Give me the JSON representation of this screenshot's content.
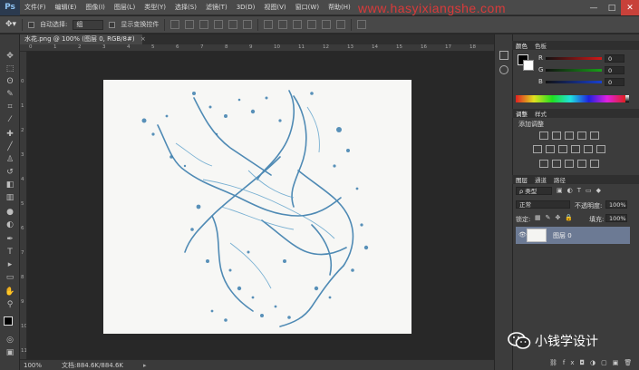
{
  "app": {
    "logo": "Ps"
  },
  "menu": [
    "文件(F)",
    "编辑(E)",
    "图像(I)",
    "图层(L)",
    "类型(Y)",
    "选择(S)",
    "滤镜(T)",
    "3D(D)",
    "视图(V)",
    "窗口(W)",
    "帮助(H)"
  ],
  "watermark": "www.hasyixiangshe.com",
  "window_controls": [
    "—",
    "□",
    "✕"
  ],
  "options": {
    "auto_select_label": "自动选择:",
    "auto_select_value": "组",
    "show_transform_label": "显示变换控件"
  },
  "document": {
    "tab_title": "水花.png @ 100% (图层 0, RGB/8#)",
    "tab_close": "×",
    "zoom": "100%",
    "doc_size": "文档:884.6K/884.6K",
    "ruler_top": [
      "0",
      "1",
      "2",
      "3",
      "4",
      "5",
      "6",
      "7",
      "8",
      "9",
      "10",
      "11",
      "12",
      "13",
      "14",
      "15",
      "16",
      "17",
      "18",
      "19"
    ],
    "ruler_left": [
      "0",
      "1",
      "2",
      "3",
      "4",
      "5",
      "6",
      "7",
      "8",
      "9",
      "10",
      "11",
      "12"
    ]
  },
  "panels": {
    "color_tabs": [
      "颜色",
      "色板"
    ],
    "color_rows": [
      {
        "label": "R",
        "value": "0",
        "color": "#d01818"
      },
      {
        "label": "G",
        "value": "0",
        "color": "#18a018"
      },
      {
        "label": "B",
        "value": "0",
        "color": "#1840d0"
      }
    ],
    "adjust_tabs": [
      "调整",
      "样式"
    ],
    "adjust_title": "添加调整",
    "layers_tabs": [
      "图层",
      "通道",
      "路径"
    ],
    "layer_filter": "ρ 类型",
    "blend_mode": "正常",
    "opacity_label": "不透明度:",
    "opacity_value": "100%",
    "lock_label": "锁定:",
    "fill_label": "填充:",
    "fill_value": "100%",
    "layer_name": "图层 0",
    "eye": "👁"
  },
  "footer_mark": {
    "text": "小钱学设计"
  },
  "colors": {
    "accent_red": "#c8413a",
    "selected_layer": "#6c7a94",
    "splash": "#3d7fae"
  }
}
